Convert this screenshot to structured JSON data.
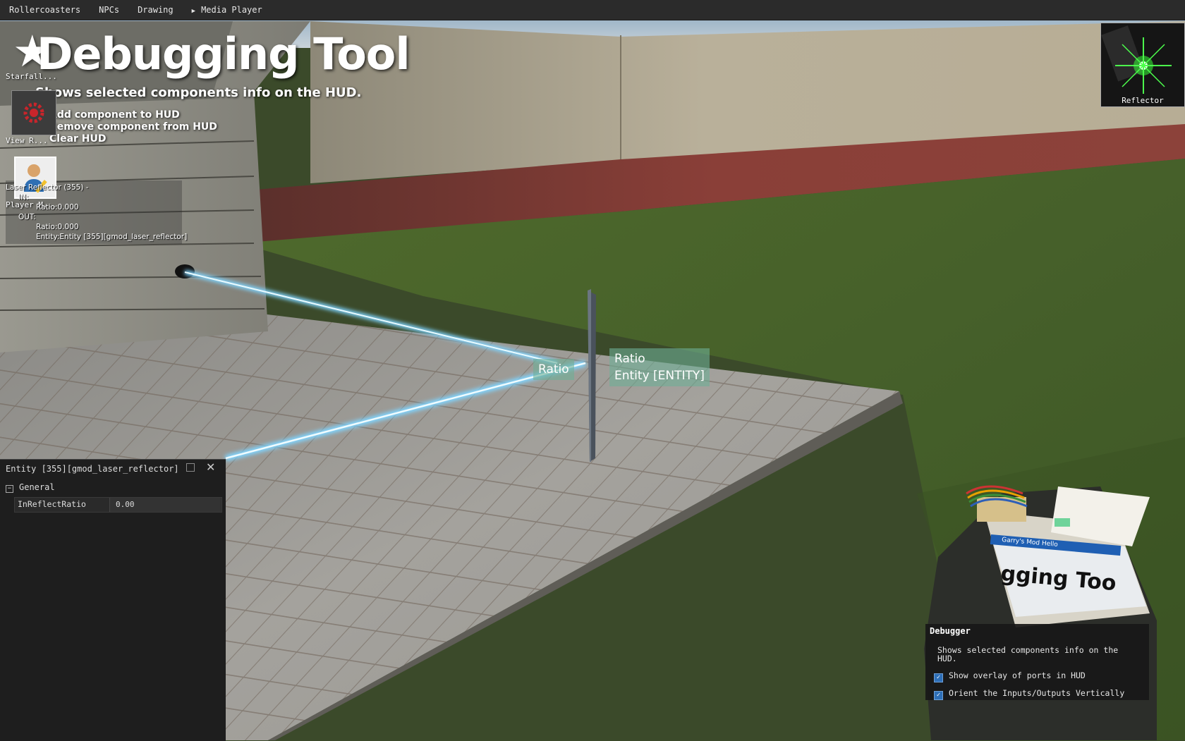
{
  "menubar": {
    "items": [
      "Rollercoasters",
      "NPCs",
      "Drawing",
      "Media Player"
    ]
  },
  "tool": {
    "title": "Debugging Tool",
    "description": "Shows selected components info on the HUD.",
    "instructions": [
      "Add component to HUD",
      "Remove component from HUD",
      "Clear HUD"
    ]
  },
  "side": {
    "starfall_label": "Starfall...",
    "view_label": "View R...",
    "player_label": "Player M..."
  },
  "debug_overlay": {
    "header": "Laser Reflector (355) -",
    "in_label": "IN:",
    "in_value": "Ratio:0.000",
    "out_label": "OUT:",
    "out_values": [
      "Ratio:0.000",
      "Entity:Entity [355][gmod_laser_reflector]"
    ]
  },
  "ports": {
    "input_label": "Ratio",
    "output_line1": "Ratio",
    "output_line2": "Entity [ENTITY]"
  },
  "reflector": {
    "label": "Reflector"
  },
  "entity_panel": {
    "title": "Entity [355][gmod_laser_reflector]",
    "section": "General",
    "property_name": "InReflectRatio",
    "property_value": "0.00"
  },
  "viewmodel_screen": {
    "header": "Garry's Mod Hello",
    "big_text": "gging Too"
  },
  "debugger": {
    "title": "Debugger",
    "description": "Shows selected components info on the HUD.",
    "options": [
      {
        "label": "Show overlay of ports in HUD",
        "checked": true
      },
      {
        "label": "Orient the Inputs/Outputs Vertically",
        "checked": true
      }
    ]
  },
  "colors": {
    "laser": "#aee8ff",
    "port_label_bg": "#6eaf96",
    "checkbox": "#2e6fb8"
  }
}
